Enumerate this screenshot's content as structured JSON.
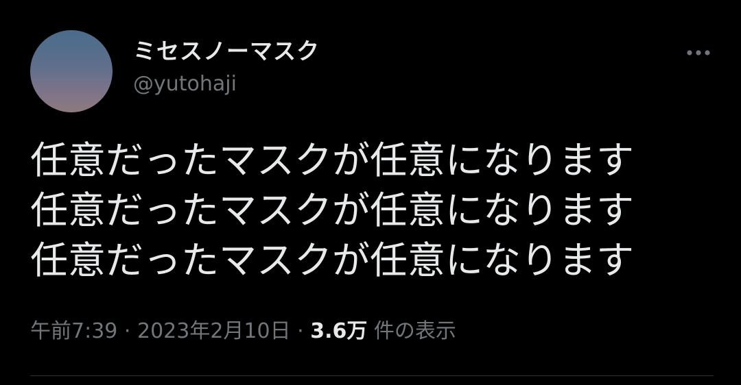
{
  "author": {
    "display_name": "ミセスノーマスク",
    "handle": "@yutohaji"
  },
  "tweet": {
    "text": "任意だったマスクが任意になります\n任意だったマスクが任意になります\n任意だったマスクが任意になります",
    "time": "午前7:39",
    "separator": " · ",
    "date": "2023年2月10日",
    "views_count": "3.6万",
    "views_label": " 件の表示"
  },
  "icons": {
    "more": "more-horizontal-icon"
  },
  "colors": {
    "background": "#000000",
    "primary_text": "#e7e9ea",
    "secondary_text": "#71767b",
    "divider": "#2f3336"
  }
}
